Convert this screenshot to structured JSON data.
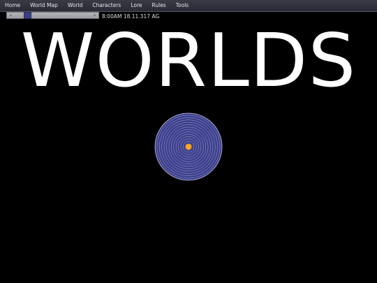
{
  "nav": {
    "items": [
      {
        "label": "Home",
        "name": "nav-home"
      },
      {
        "label": "World Map",
        "name": "nav-world-map"
      },
      {
        "label": "World",
        "name": "nav-world"
      },
      {
        "label": "Characters",
        "name": "nav-characters"
      },
      {
        "label": "Lore",
        "name": "nav-lore"
      },
      {
        "label": "Rules",
        "name": "nav-rules"
      },
      {
        "label": "Tools",
        "name": "nav-tools"
      }
    ]
  },
  "time_slider": {
    "position": 0.2,
    "left_arrow": "◂",
    "right_arrow": "▸"
  },
  "datetime": "8:00AM 18.11.317 AG",
  "title": "WORLDS",
  "orbit_map": {
    "star_color": "#f5a623",
    "disc_color": "#3c3f8c",
    "ring_color": "#c8c8e8",
    "ring_count": 12
  }
}
